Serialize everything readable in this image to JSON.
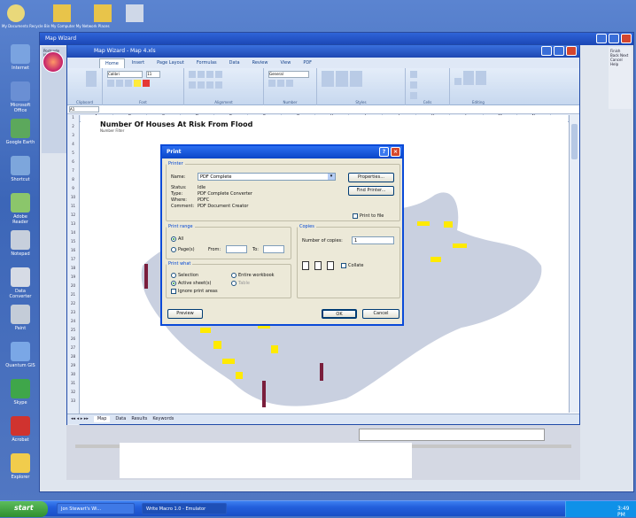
{
  "desktop": {
    "top_labels": "My Documents   Recycle Bin   My Computer   My Network Places",
    "left_icons": [
      "Internet",
      "Microsoft Office",
      "Google Earth",
      "Shortcut",
      "Adobe Reader",
      "Notepad",
      "Data Converter",
      "Paint",
      "Quantum GIS",
      "Skype",
      "Acrobat",
      "Explorer"
    ]
  },
  "outer_window": {
    "title": "Map Wizard",
    "side_text": "Postcode Map",
    "right_text": "Finish Back Next Cancel Help"
  },
  "excel": {
    "title": "Map Wizard - Map 4.xls",
    "tabs": [
      "Home",
      "Insert",
      "Page Layout",
      "Formulas",
      "Data",
      "Review",
      "View",
      "PDF"
    ],
    "groups": [
      "Clipboard",
      "Font",
      "Alignment",
      "Number",
      "Styles",
      "Cells",
      "Editing"
    ],
    "font_name": "Calibri",
    "font_size": "11",
    "number_format": "General",
    "name_box": "A1",
    "columns": [
      "A",
      "B",
      "C",
      "D",
      "E",
      "F",
      "G",
      "H",
      "I",
      "J",
      "K",
      "L",
      "M",
      "N",
      "O"
    ],
    "rows": [
      "1",
      "2",
      "3",
      "4",
      "5",
      "6",
      "7",
      "8",
      "9",
      "10",
      "11",
      "12",
      "13",
      "14",
      "15",
      "16",
      "17",
      "18",
      "19",
      "20",
      "21",
      "22",
      "23",
      "24",
      "25",
      "26",
      "27",
      "28",
      "29",
      "30",
      "31",
      "32",
      "33"
    ],
    "sheet_title": "Number Of Houses At Risk From Flood",
    "sheet_subtitle": "Number Filter",
    "sheet_tabs": [
      "Map",
      "Data",
      "Results",
      "Keywords"
    ]
  },
  "dialog": {
    "title": "Print",
    "printer_legend": "Printer",
    "name_label": "Name:",
    "printer_name": "PDF Complete",
    "status_label": "Status:",
    "status_value": "Idle",
    "type_label": "Type:",
    "type_value": "PDF Complete Converter",
    "where_label": "Where:",
    "where_value": "PDFC",
    "comment_label": "Comment:",
    "comment_value": "PDF Document Creator",
    "properties_button": "Properties...",
    "find_printer_button": "Find Printer...",
    "print_to_file_label": "Print to file",
    "print_range_legend": "Print range",
    "all_label": "All",
    "pages_label": "Page(s)",
    "from_label": "From:",
    "to_label": "To:",
    "print_what_legend": "Print what",
    "selection_label": "Selection",
    "active_sheets_label": "Active sheet(s)",
    "entire_workbook_label": "Entire workbook",
    "table_label": "Table",
    "ignore_areas_label": "Ignore print areas",
    "copies_legend": "Copies",
    "copies_label": "Number of copies:",
    "copies_value": "1",
    "collate_label": "Collate",
    "preview_button": "Preview",
    "ok_button": "OK",
    "cancel_button": "Cancel"
  },
  "taskbar": {
    "start_label": "start",
    "tasks": [
      "Jon Stewart's Wi...",
      "Write Macro 1.0 - Emulator"
    ],
    "clock": "3:49 PM"
  },
  "colors": {
    "map_land": "#c9d0e0",
    "map_risk_yellow": "#ffea00",
    "map_risk_maroon": "#7a1e3c",
    "xp_blue": "#0a46c8",
    "dialog_bg": "#ece9d8"
  }
}
